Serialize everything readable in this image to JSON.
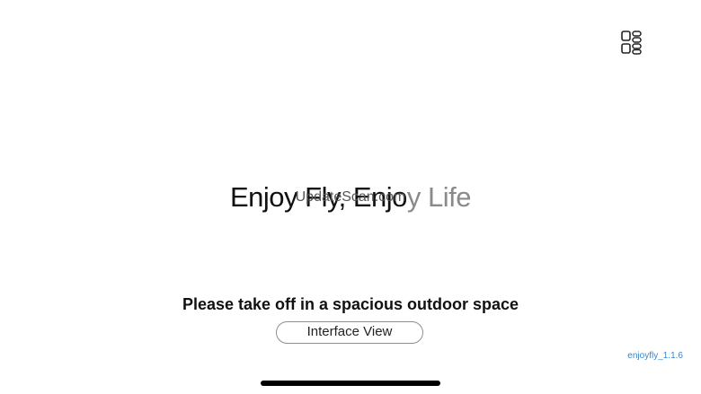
{
  "header": {
    "menu_icon": "grid-list-icon"
  },
  "main": {
    "slogan_part1": "Enjoy Fly, Enjo",
    "slogan_part2": "y Life",
    "update_scan_text": "UpdateScan.com",
    "takeoff_notice": "Please take off in a spacious outdoor space",
    "interface_view_label": "Interface View"
  },
  "footer": {
    "version": "enjoyfly_1.1.6"
  },
  "colors": {
    "background": "#ffffff",
    "text_primary": "#111111",
    "slogan_fade": "#8a8a8a",
    "version_link": "#3a86c8",
    "button_border": "#8f8f8f"
  }
}
